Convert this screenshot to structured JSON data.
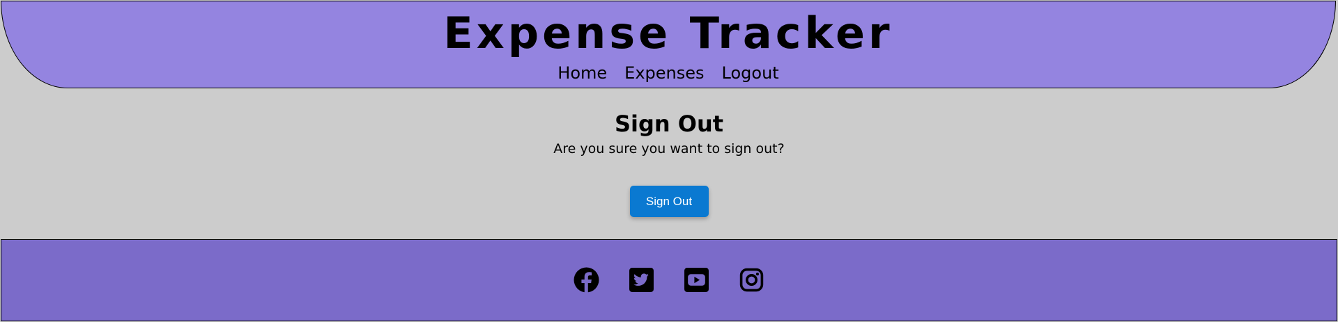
{
  "header": {
    "title": "Expense Tracker",
    "nav": [
      {
        "label": "Home"
      },
      {
        "label": "Expenses"
      },
      {
        "label": "Logout"
      }
    ]
  },
  "main": {
    "heading": "Sign Out",
    "prompt": "Are you sure you want to sign out?",
    "button_label": "Sign Out"
  },
  "footer": {
    "social_icons": [
      "facebook-icon",
      "twitter-icon",
      "youtube-icon",
      "instagram-icon"
    ]
  },
  "colors": {
    "header_bg": "#9484e0",
    "page_bg": "#cccccc",
    "footer_bg": "#7b6bc9",
    "button_bg": "#0a79d1"
  }
}
